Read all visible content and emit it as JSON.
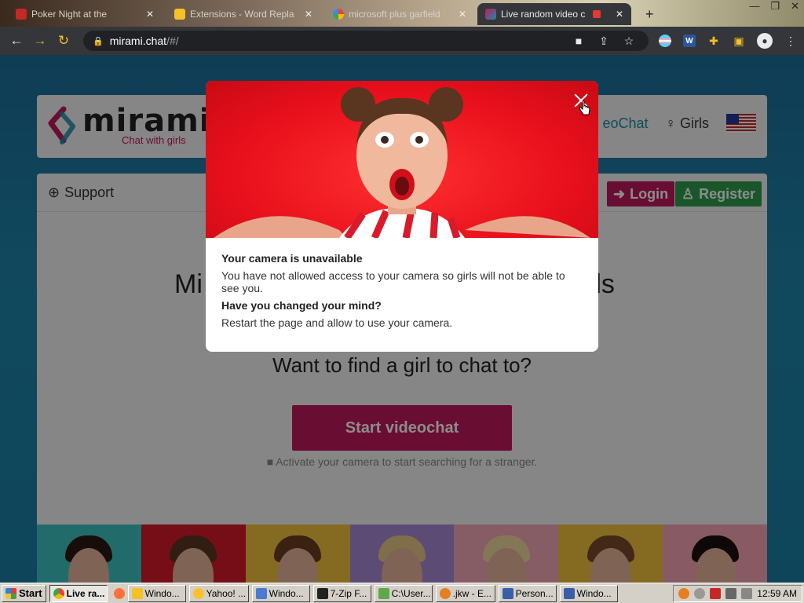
{
  "browser": {
    "tabs": [
      {
        "label": "Poker Night at the",
        "active": false
      },
      {
        "label": "Extensions - Word Repla",
        "active": false
      },
      {
        "label": "microsoft plus garfield",
        "active": false
      },
      {
        "label": "Live random video c",
        "active": true
      }
    ],
    "new_tab_label": "+",
    "address": {
      "host": "mirami.chat",
      "path": "/#/"
    }
  },
  "site": {
    "logo_text": "mirami",
    "logo_tagline": "Chat with girls",
    "nav": {
      "videochat": "eoChat",
      "girls": "Girls"
    },
    "support": "Support",
    "login": "Login",
    "register": "Register",
    "hero_left": "Mi",
    "hero_right": "rls",
    "find_girl": "Want to find a girl to chat to?",
    "start_videochat": "Start videochat",
    "camera_note": "Activate your camera to start searching for a stranger."
  },
  "modal": {
    "heading1": "Your camera is unavailable",
    "text1": "You have not allowed access to your camera so girls will not be able to see you.",
    "heading2": "Have you changed your mind?",
    "text2": "Restart the page and allow to use your camera."
  },
  "taskbar": {
    "start": "Start",
    "tasks": [
      "Live ra...",
      "Windo...",
      "Yahoo! ...",
      "Windo...",
      "7-Zip F...",
      "C:\\User...",
      ".jkw - E...",
      "Person...",
      "Windo..."
    ],
    "clock": "12:59 AM"
  },
  "colors": {
    "brand_pink": "#c2185b",
    "register_green": "#2e9e4e",
    "page_bg": "#1f84ab"
  }
}
